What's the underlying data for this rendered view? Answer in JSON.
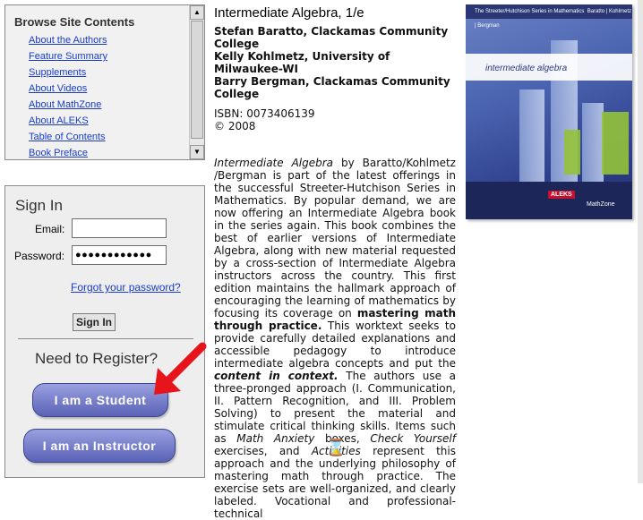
{
  "browse": {
    "title": "Browse Site Contents",
    "items": [
      "About the Authors",
      "Feature Summary",
      "Supplements",
      "About Videos",
      "About MathZone",
      "About ALEKS",
      "Table of Contents",
      "Book Preface"
    ]
  },
  "signin": {
    "title": "Sign In",
    "email_label": "Email:",
    "email_value": "",
    "password_label": "Password:",
    "password_value": "●●●●●●●●●●●●",
    "forgot_label": "Forgot your password?",
    "button_label": "Sign In",
    "register_heading": "Need to Register?",
    "student_button": "I am a Student",
    "instructor_button": "I am an Instructor"
  },
  "book": {
    "title": "Intermediate Algebra, 1/e",
    "authors": [
      "Stefan Baratto, Clackamas Community College",
      "Kelly Kohlmetz, University of Milwaukee-WI",
      "Barry Bergman, Clackamas Community College"
    ],
    "isbn": "ISBN: 0073406139",
    "copyright": "© 2008",
    "desc": {
      "em1": "Intermediate Algebra",
      "t1": " by Baratto/Kohlmetz /Bergman is part of the latest offerings in the successful Streeter-Hutchison Series in Mathematics. By popular demand, we are now offering an Intermediate Algebra book in the series again. This book combines the best of earlier versions of Intermediate Algebra, along with new material requested by a cross-section of Intermediate Algebra instructors across the country. This first edition maintains the hallmark approach of encouraging the learning of mathematics by focusing its coverage on ",
      "b1": "mastering math through practice.",
      "t2": " This worktext seeks to provide carefully detailed explanations and accessible pedagogy to introduce intermediate algebra concepts and put the ",
      "b2": "content in context.",
      "t3": " The authors use a three-pronged approach (I. Communication, II. Pattern Recognition, and III. Problem Solving) to present the material and stimulate critical thinking skills. Items such as ",
      "em2": "Math Anxiety",
      "t4": " boxes, ",
      "em3": "Check Yourself",
      "t5": " exercises, and ",
      "em4": "Activities",
      "t6": " represent this approach and the underlying philosophy of mastering math through practice. The exercise sets are well-organized, and clearly labeled. Vocational and professional-technical"
    }
  },
  "cover": {
    "series": "The Streeter/Hutchison Series in Mathematics",
    "authors": "Baratto | Kohlmetz | Bergman",
    "subtitle": "intermediate algebra",
    "logo1": "ALEKS",
    "logo2": "MathZone"
  },
  "colors": {
    "link": "#1a3cc8",
    "pill": "#5a62b6",
    "arrow": "#e8141c"
  }
}
